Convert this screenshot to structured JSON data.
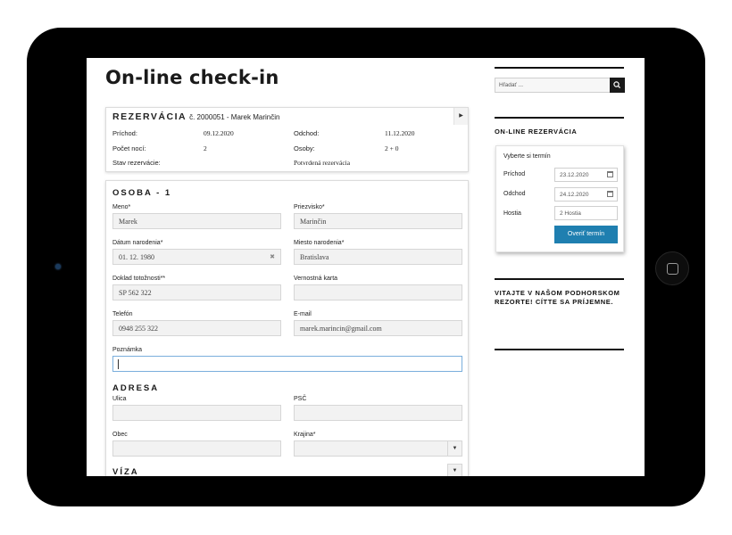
{
  "page": {
    "title": "On-line check-in"
  },
  "reservation": {
    "heading": "REZERVÁCIA",
    "number_text": "č. 2000051 - Marek Marinčin",
    "toggle_icon": "chevron-right-icon",
    "rows": [
      {
        "l1": "Príchod:",
        "v1": "09.12.2020",
        "l2": "Odchod:",
        "v2": "11.12.2020"
      },
      {
        "l1": "Počet nocí:",
        "v1": "2",
        "l2": "Osoby:",
        "v2": "2 + 0"
      },
      {
        "l1": "Stav rezervácie:",
        "v1": "",
        "l2": "Potvrdená rezervácia",
        "v2": ""
      }
    ]
  },
  "person": {
    "heading": "OSOBA - 1",
    "fields": {
      "first_name": {
        "label": "Meno*",
        "value": "Marek"
      },
      "last_name": {
        "label": "Priezvisko*",
        "value": "Marinčin"
      },
      "birth_date": {
        "label": "Dátum narodenia*",
        "value": "01. 12. 1980"
      },
      "birth_place": {
        "label": "Miesto narodenia*",
        "value": "Bratislava"
      },
      "id_document": {
        "label": "Doklad totožnosti**",
        "value": "SP 562 322"
      },
      "loyalty_card": {
        "label": "Vernostná karta",
        "value": ""
      },
      "phone": {
        "label": "Telefón",
        "value": "0948 255 322"
      },
      "email": {
        "label": "E-mail",
        "value": "marek.marincin@gmail.com"
      },
      "note": {
        "label": "Poznámka",
        "value": ""
      }
    }
  },
  "address": {
    "heading": "ADRESA",
    "fields": {
      "street": {
        "label": "Ulica",
        "value": ""
      },
      "zip": {
        "label": "PSČ",
        "value": ""
      },
      "city": {
        "label": "Obec",
        "value": ""
      },
      "country": {
        "label": "Krajina*",
        "value": ""
      }
    }
  },
  "visa": {
    "heading": "VÍZA"
  },
  "sidebar": {
    "search_placeholder": "Hľadať ...",
    "search_icon": "search-icon",
    "booking_heading": "ON-LINE REZERVÁCIA",
    "booking": {
      "title": "Vyberte si termín",
      "arrival_label": "Príchod",
      "arrival_value": "23.12.2020",
      "departure_label": "Odchod",
      "departure_value": "24.12.2020",
      "guests_label": "Hostia",
      "guests_value": "2 Hostia",
      "button": "Overiť termín"
    },
    "welcome_text": "VITAJTE V NAŠOM PODHORSKOM REZORTE! CÍTTE SA PRÍJEMNE."
  },
  "colors": {
    "accent": "#1f7fb0",
    "frame": "#000000"
  }
}
